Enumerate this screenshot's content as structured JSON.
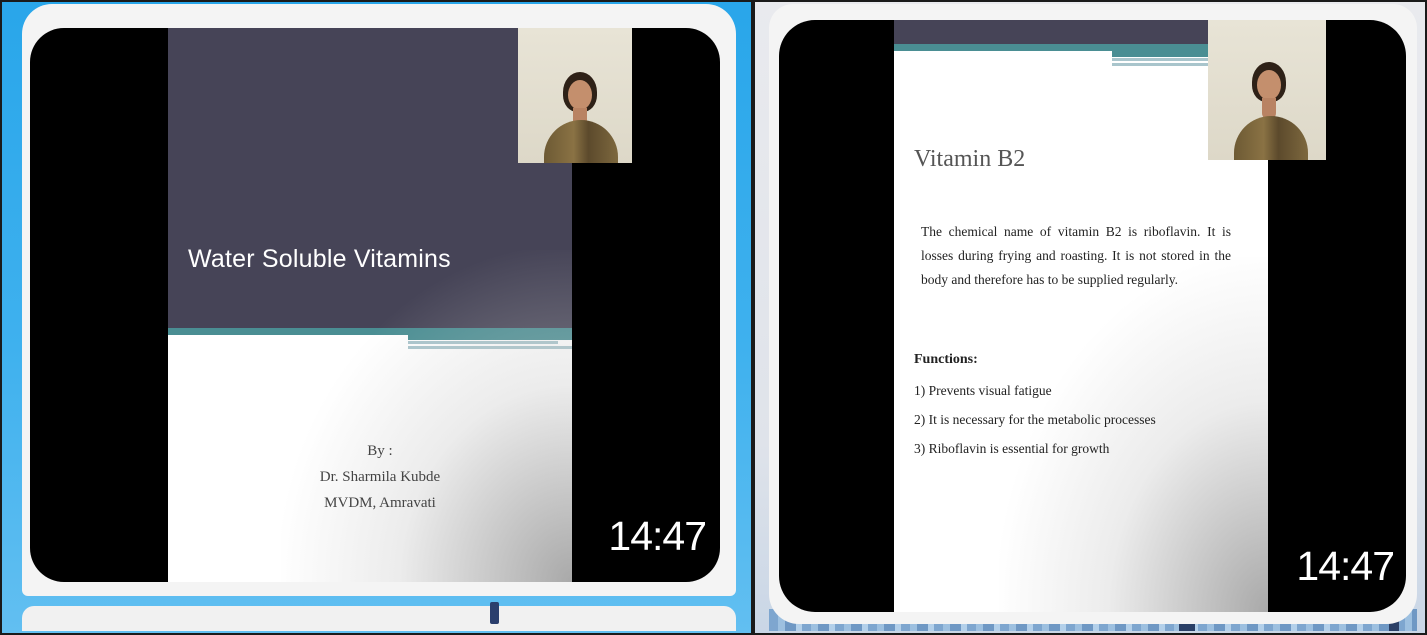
{
  "videos": [
    {
      "slide": {
        "title": "Water Soluble Vitamins",
        "byline": [
          "By :",
          "Dr. Sharmila Kubde",
          "MVDM, Amravati"
        ]
      },
      "duration": "14:47",
      "icons": {
        "webcam": "presenter-webcam-icon"
      }
    },
    {
      "slide": {
        "title": "Vitamin B2",
        "paragraph": "The chemical name of vitamin B2 is riboflavin. It is losses during frying and roasting. It is not stored in the body and therefore has to be supplied regularly.",
        "functions_heading": "Functions:",
        "functions": [
          "1) Prevents visual fatigue",
          "2) It is necessary for the metabolic processes",
          "3) Riboflavin is essential for growth"
        ]
      },
      "duration": "14:47",
      "icons": {
        "webcam": "presenter-webcam-icon"
      }
    }
  ],
  "colors": {
    "left_background": "#29a6ea",
    "right_background": "#e9eaee",
    "slide_band": "#464457",
    "slide_accent": "#4a8e93",
    "duration_text": "#ffffff"
  }
}
